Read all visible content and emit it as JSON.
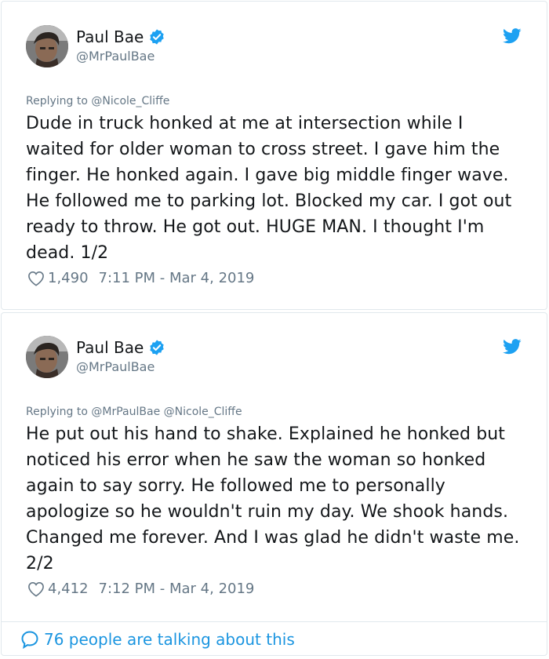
{
  "tweets": [
    {
      "author": {
        "name": "Paul Bae",
        "handle": "@MrPaulBae"
      },
      "reply_prefix": "Replying to ",
      "reply_mentions": "@Nicole_Cliffe",
      "text": "Dude in truck honked at me at intersection while I waited for older woman to cross street. I gave him the finger. He honked again. I gave big middle finger wave. He followed me to parking lot. Blocked my car. I got out ready to throw. He got out. HUGE MAN. I thought I'm dead. 1/2",
      "likes": "1,490",
      "timestamp": "7:11 PM - Mar 4, 2019"
    },
    {
      "author": {
        "name": "Paul Bae",
        "handle": "@MrPaulBae"
      },
      "reply_prefix": "Replying to ",
      "reply_mentions": "@MrPaulBae @Nicole_Cliffe",
      "text": "He put out his hand to shake. Explained he honked but noticed his error when he saw the woman so honked again to say sorry. He followed me to personally apologize so he wouldn't ruin my day. We shook hands. Changed me forever. And I was glad he didn't waste me. 2/2",
      "likes": "4,412",
      "timestamp": "7:12 PM - Mar 4, 2019"
    }
  ],
  "footer": {
    "talking": "76 people are talking about this"
  },
  "colors": {
    "accent": "#1da1f2",
    "link": "#1b95e0",
    "muted": "#657786",
    "text": "#14171a",
    "border": "#e1e8ed"
  },
  "icons": [
    "verified-badge-icon",
    "twitter-bird-icon",
    "heart-icon",
    "speech-bubble-icon"
  ]
}
